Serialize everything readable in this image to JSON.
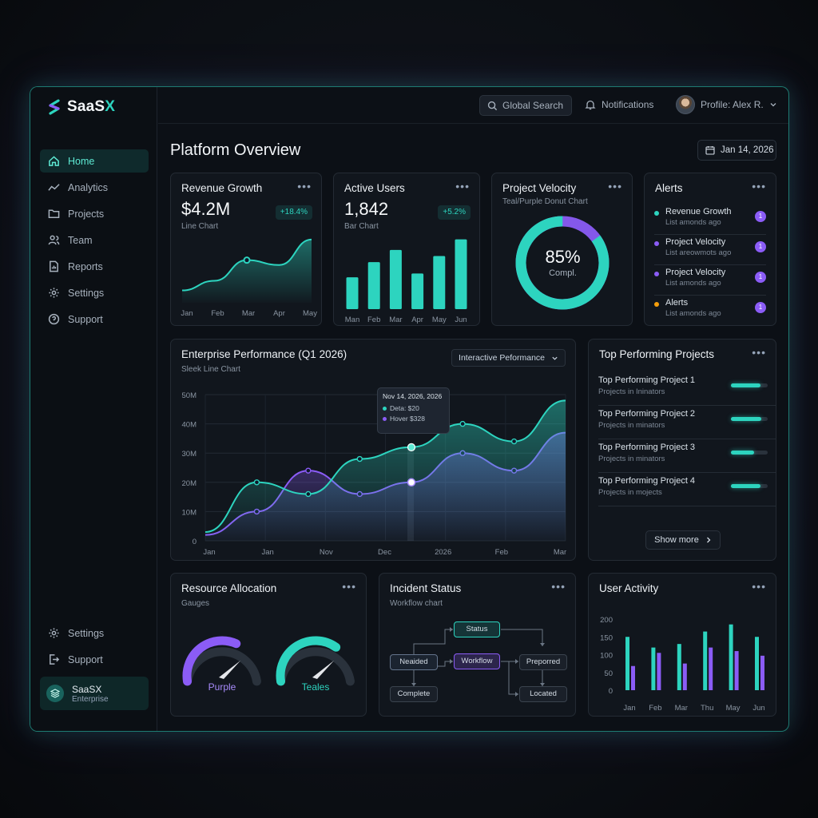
{
  "app": {
    "logo_main": "SaaS",
    "logo_accent": "X"
  },
  "sidebar": {
    "items": [
      {
        "label": "Home",
        "icon": "home-icon",
        "active": true
      },
      {
        "label": "Analytics",
        "icon": "analytics-icon"
      },
      {
        "label": "Projects",
        "icon": "folder-icon"
      },
      {
        "label": "Team",
        "icon": "team-icon"
      },
      {
        "label": "Reports",
        "icon": "reports-icon"
      },
      {
        "label": "Settings",
        "icon": "gear-icon"
      },
      {
        "label": "Support",
        "icon": "help-icon"
      }
    ],
    "bottom_items": [
      {
        "label": "Settings",
        "icon": "gear-icon"
      },
      {
        "label": "Support",
        "icon": "logout-icon"
      }
    ],
    "enterprise": {
      "title": "SaaSX",
      "subtitle": "Enterprise"
    }
  },
  "topbar": {
    "search_placeholder": "Global Search",
    "notifications_label": "Notifications",
    "profile_label": "Profile: Alex R."
  },
  "page": {
    "title": "Platform Overview",
    "date": "Jan 14, 2026"
  },
  "revenue": {
    "title": "Revenue Growth",
    "value": "$4.2M",
    "change": "+18.4%",
    "subtitle": "Line Chart",
    "chart_data": {
      "type": "area",
      "categories": [
        "Jan",
        "Feb",
        "Mar",
        "Apr",
        "May"
      ],
      "values": [
        0.18,
        0.32,
        0.62,
        0.55,
        0.92
      ],
      "highlight_index": 2
    }
  },
  "users": {
    "title": "Active Users",
    "value": "1,842",
    "change": "+5.2%",
    "subtitle": "Bar Chart",
    "chart_data": {
      "type": "bar",
      "categories": [
        "Man",
        "Feb",
        "Mar",
        "Apr",
        "May",
        "Jun"
      ],
      "values": [
        0.42,
        0.62,
        0.78,
        0.47,
        0.7,
        0.92
      ]
    }
  },
  "velocity": {
    "title": "Project Velocity",
    "subtitle": "Teal/Purple Donut Chart",
    "value": "85%",
    "value_label": "Compl.",
    "chart_data": {
      "type": "pie",
      "percent": 85,
      "colors": [
        "#2dd4bf",
        "#8b5cf6"
      ]
    }
  },
  "alerts": {
    "title": "Alerts",
    "items": [
      {
        "title": "Revenue Growth",
        "subtitle": "List amonds ago",
        "dot": "#2dd4bf",
        "badge": "1"
      },
      {
        "title": "Project Velocity",
        "subtitle": "List areowmots ago",
        "dot": "#8b5cf6",
        "badge": "1"
      },
      {
        "title": "Project Velocity",
        "subtitle": "List amonds ago",
        "dot": "#8b5cf6",
        "badge": "1"
      },
      {
        "title": "Alerts",
        "subtitle": "List amonds ago",
        "dot": "#f59e0b",
        "badge": "1"
      }
    ]
  },
  "performance": {
    "title": "Enterprise Performance (Q1 2026)",
    "subtitle": "Sleek Line Chart",
    "dropdown": "Interactive Peformance",
    "tooltip": {
      "date": "Nov 14, 2026, 2026",
      "line1": "Deta: $20",
      "line2": "Hover $328"
    },
    "chart_data": {
      "type": "area",
      "x_labels": [
        "Jan",
        "Jan",
        "Nov",
        "Dec",
        "2026",
        "Feb",
        "Mar"
      ],
      "y_ticks": [
        "50M",
        "40M",
        "30M",
        "20M",
        "10M",
        "0"
      ],
      "ylim": [
        0,
        50
      ],
      "series": [
        {
          "color": "#2dd4bf",
          "values": [
            3,
            20,
            16,
            28,
            32,
            40,
            34,
            48
          ]
        },
        {
          "color": "#8b5cf6",
          "values": [
            2,
            10,
            24,
            16,
            20,
            30,
            24,
            37
          ]
        }
      ]
    }
  },
  "top_projects": {
    "title": "Top Performing Projects",
    "items": [
      {
        "title": "Top Performing Project 1",
        "subtitle": "Projects in Ininators",
        "progress": 0.8
      },
      {
        "title": "Top Performing Project 2",
        "subtitle": "Projects in minators",
        "progress": 0.82
      },
      {
        "title": "Top Performing Project 3",
        "subtitle": "Projects in minators",
        "progress": 0.62
      },
      {
        "title": "Top Performing Project 4",
        "subtitle": "Projects in mojects",
        "progress": 0.8
      }
    ],
    "show_more": "Show more"
  },
  "resources": {
    "title": "Resource Allocation",
    "subtitle": "Gauges",
    "gauges": [
      {
        "label": "Purple",
        "color": "#8b5cf6",
        "value": 0.62
      },
      {
        "label": "Teales",
        "color": "#2dd4bf",
        "value": 0.68
      }
    ]
  },
  "incidents": {
    "title": "Incident Status",
    "subtitle": "Workflow chart",
    "nodes": {
      "status": "Status",
      "needed": "Neaided",
      "workflow": "Workflow",
      "prepared": "Preporred",
      "complete": "Complete",
      "located": "Located"
    }
  },
  "activity": {
    "title": "User Activity",
    "chart_data": {
      "type": "bar",
      "categories": [
        "Jan",
        "Feb",
        "Mar",
        "Thu",
        "May",
        "Jun"
      ],
      "y_ticks": [
        "200",
        "150",
        "100",
        "50",
        "0"
      ],
      "ylim": [
        0,
        200
      ],
      "series": [
        {
          "color": "#2dd4bf",
          "values": [
            150,
            120,
            130,
            165,
            185,
            150
          ]
        },
        {
          "color": "#8b5cf6",
          "values": [
            68,
            105,
            75,
            120,
            110,
            97
          ]
        }
      ]
    }
  }
}
